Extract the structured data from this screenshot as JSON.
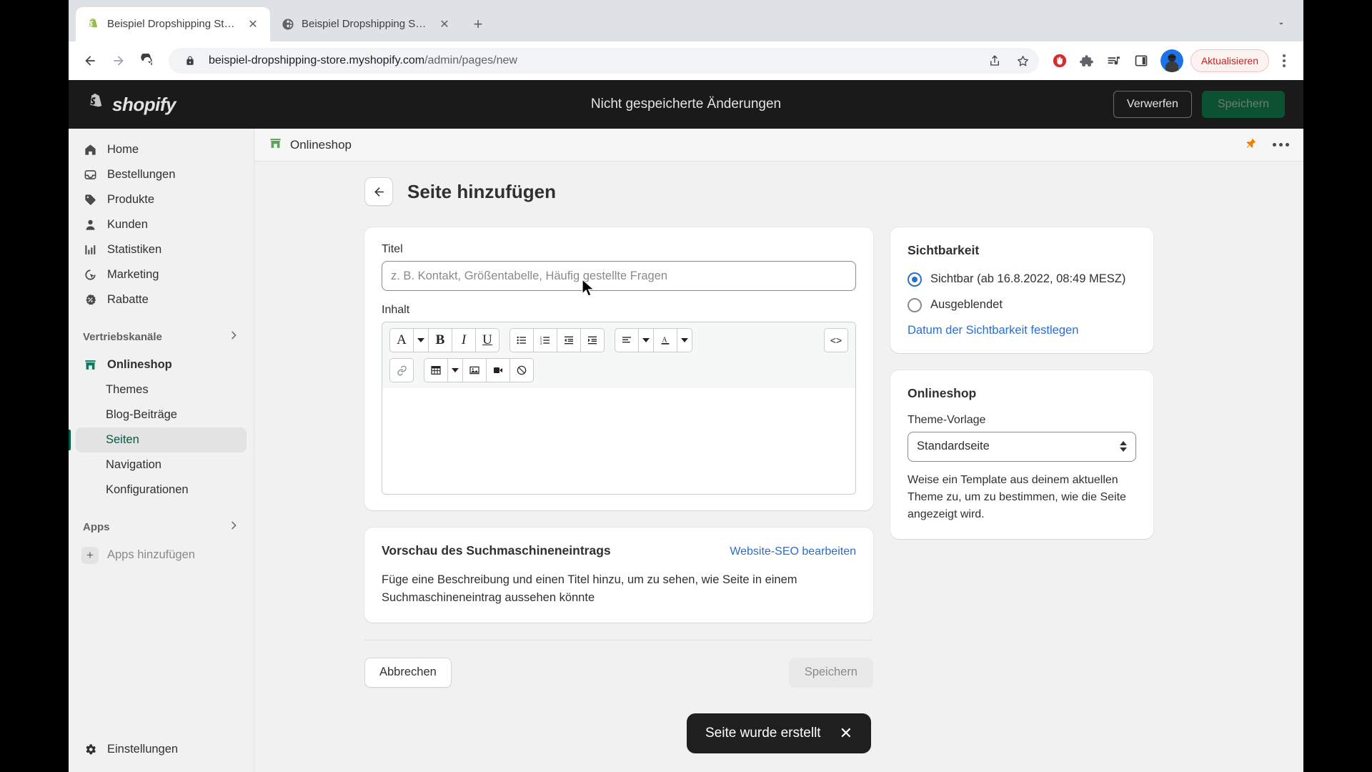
{
  "browser": {
    "tabs": [
      {
        "title": "Beispiel Dropshipping Store · S",
        "favicon": "shopify-favicon",
        "active": true
      },
      {
        "title": "Beispiel Dropshipping Store",
        "favicon": "globe-favicon",
        "active": false
      }
    ],
    "new_tab_label": "+",
    "tabstrip_menu_icon": "chevron-down-icon",
    "nav": {
      "back_icon": "back-arrow-icon",
      "forward_icon": "forward-arrow-icon",
      "reload_icon": "reload-icon"
    },
    "omnibox": {
      "lock_icon": "lock-icon",
      "url_domain": "beispiel-dropshipping-store.myshopify.com",
      "url_path": "/admin/pages/new",
      "share_icon": "share-icon",
      "bookmark_icon": "star-icon"
    },
    "extensions": [
      {
        "name": "adblock-icon"
      },
      {
        "name": "puzzle-extensions-icon"
      },
      {
        "name": "playlist-icon"
      },
      {
        "name": "sidepanel-icon"
      }
    ],
    "profile_icon": "avatar",
    "update_label": "Aktualisieren",
    "menu_icon": "kebab-menu-icon"
  },
  "topbar": {
    "logo_text": "shopify",
    "logo_icon": "shopify-bag-icon",
    "unsaved_label": "Nicht gespeicherte Änderungen",
    "discard_label": "Verwerfen",
    "save_label": "Speichern"
  },
  "sidebar": {
    "items": [
      {
        "label": "Home",
        "icon": "home-icon"
      },
      {
        "label": "Bestellungen",
        "icon": "orders-inbox-icon"
      },
      {
        "label": "Produkte",
        "icon": "product-tag-icon"
      },
      {
        "label": "Kunden",
        "icon": "customer-person-icon"
      },
      {
        "label": "Statistiken",
        "icon": "analytics-bars-icon"
      },
      {
        "label": "Marketing",
        "icon": "marketing-target-icon"
      },
      {
        "label": "Rabatte",
        "icon": "discount-badge-icon"
      }
    ],
    "channels_section": {
      "label": "Vertriebskanäle",
      "chevron": "chevron-right-icon"
    },
    "channel": {
      "label": "Onlineshop",
      "icon": "store-icon"
    },
    "channel_items": [
      {
        "label": "Themes",
        "active": false
      },
      {
        "label": "Blog-Beiträge",
        "active": false
      },
      {
        "label": "Seiten",
        "active": true
      },
      {
        "label": "Navigation",
        "active": false
      },
      {
        "label": "Konfigurationen",
        "active": false
      }
    ],
    "apps_section": {
      "label": "Apps",
      "chevron": "chevron-right-icon"
    },
    "add_apps": {
      "label": "Apps hinzufügen",
      "icon": "plus-icon"
    },
    "settings": {
      "label": "Einstellungen",
      "icon": "gear-icon"
    }
  },
  "context_header": {
    "icon": "store-icon",
    "title": "Onlineshop",
    "pin_icon": "pin-icon",
    "more_icon": "more-dots-icon"
  },
  "page": {
    "back_icon": "back-arrow-icon",
    "title": "Seite hinzufügen"
  },
  "form": {
    "title_label": "Titel",
    "title_placeholder": "z. B. Kontakt, Größentabelle, Häufig gestellte Fragen",
    "title_value": "",
    "content_label": "Inhalt",
    "content_value": "",
    "toolbar": {
      "groups": [
        {
          "items": [
            {
              "name": "font-style-icon",
              "glyph": "A",
              "caret": true
            },
            {
              "name": "bold-icon",
              "glyph": "B"
            },
            {
              "name": "italic-icon",
              "glyph": "I"
            },
            {
              "name": "underline-icon",
              "glyph": "U"
            }
          ]
        },
        {
          "items": [
            {
              "name": "bulleted-list-icon",
              "glyph": "☰"
            },
            {
              "name": "numbered-list-icon",
              "glyph": "≡"
            },
            {
              "name": "outdent-icon",
              "glyph": "⇤"
            },
            {
              "name": "indent-icon",
              "glyph": "⇥"
            }
          ]
        },
        {
          "items": [
            {
              "name": "align-icon",
              "glyph": "≡",
              "caret": true
            },
            {
              "name": "text-color-icon",
              "glyph": "A",
              "caret": true
            }
          ]
        }
      ],
      "code_view": {
        "name": "code-view-icon",
        "glyph": "<>"
      },
      "groups_row2": [
        {
          "items": [
            {
              "name": "link-icon",
              "glyph": "🔗"
            }
          ]
        },
        {
          "items": [
            {
              "name": "table-icon",
              "glyph": "▦",
              "caret": true
            },
            {
              "name": "insert-image-icon",
              "glyph": "🖼"
            },
            {
              "name": "insert-video-icon",
              "glyph": "🎥"
            },
            {
              "name": "clear-formatting-icon",
              "glyph": "⊘"
            }
          ]
        }
      ]
    }
  },
  "seo": {
    "title": "Vorschau des Suchmaschineneintrags",
    "edit_link": "Website-SEO bearbeiten",
    "description": "Füge eine Beschreibung und einen Titel hinzu, um zu sehen, wie Seite in einem Suchmaschineneintrag aussehen könnte"
  },
  "visibility": {
    "title": "Sichtbarkeit",
    "option_visible": "Sichtbar (ab 16.8.2022, 08:49 MESZ)",
    "option_hidden": "Ausgeblendet",
    "selected": "visible",
    "set_date_link": "Datum der Sichtbarkeit festlegen"
  },
  "online_store": {
    "title": "Onlineshop",
    "template_label": "Theme-Vorlage",
    "template_value": "Standardseite",
    "template_options": [
      "Standardseite"
    ],
    "help_text": "Weise ein Template aus deinem aktuellen Theme zu, um zu bestimmen, wie die Seite angezeigt wird."
  },
  "footer": {
    "cancel_label": "Abbrechen",
    "save_label": "Speichern"
  },
  "toast": {
    "message": "Seite wurde erstellt",
    "close_icon": "close-icon"
  },
  "colors": {
    "shopify_dark": "#1a1a1a",
    "shopify_green": "#0c5132",
    "accent_link": "#2c6ecb",
    "active_nav": "#005c46",
    "update_red": "#c5221f"
  }
}
